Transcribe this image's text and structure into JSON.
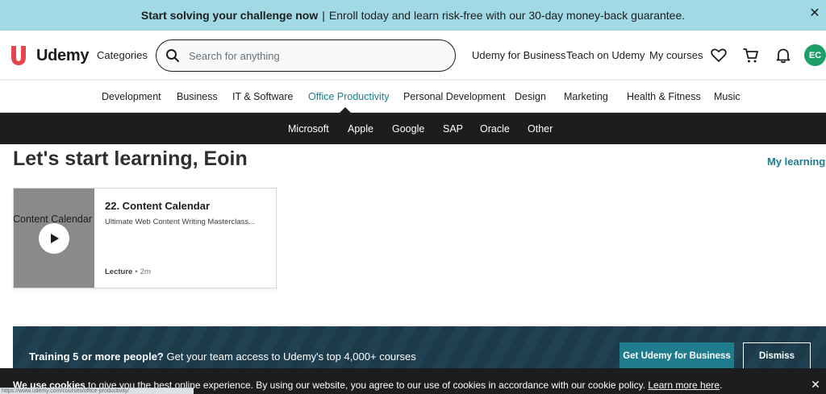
{
  "banner": {
    "strong": "Start solving your challenge now",
    "separator": "|",
    "text": "Enroll today and learn risk-free with our 30-day money-back guarantee."
  },
  "header": {
    "logo_text": "Udemy",
    "categories_label": "Categories",
    "search_placeholder": "Search for anything",
    "links": {
      "business": "Udemy for Business",
      "teach": "Teach on Udemy",
      "my_courses": "My courses"
    },
    "avatar_initials": "EC",
    "brand_color": "#a435f0",
    "avatar_color": "#1e9f6a"
  },
  "categories": [
    "Development",
    "Business",
    "IT & Software",
    "Office Productivity",
    "Personal Development",
    "Design",
    "Marketing",
    "Health & Fitness",
    "Music"
  ],
  "active_category": "Office Productivity",
  "subcategories": [
    "Microsoft",
    "Apple",
    "Google",
    "SAP",
    "Oracle",
    "Other"
  ],
  "main": {
    "greeting": "Let's start learning, Eoin",
    "my_learning": "My learning",
    "card": {
      "thumb_text": "Content Calendar",
      "title": "22. Content Calendar",
      "subtitle": "Ultimate Web Content Writing Masterclass...",
      "type": "Lecture",
      "duration": "2m"
    }
  },
  "promo": {
    "strong": "Training 5 or more people?",
    "text": "Get your team access to Udemy's top 4,000+ courses",
    "primary_button": "Get Udemy for Business",
    "dismiss_button": "Dismiss"
  },
  "cookie": {
    "strong": "We use cookies",
    "text": "to give you the best online experience. By using our website, you agree to our use of cookies in accordance with our cookie policy.",
    "link": "Learn more here",
    "period": "."
  },
  "status_url": "https://www.udemy.com/courses/office-productivity/"
}
